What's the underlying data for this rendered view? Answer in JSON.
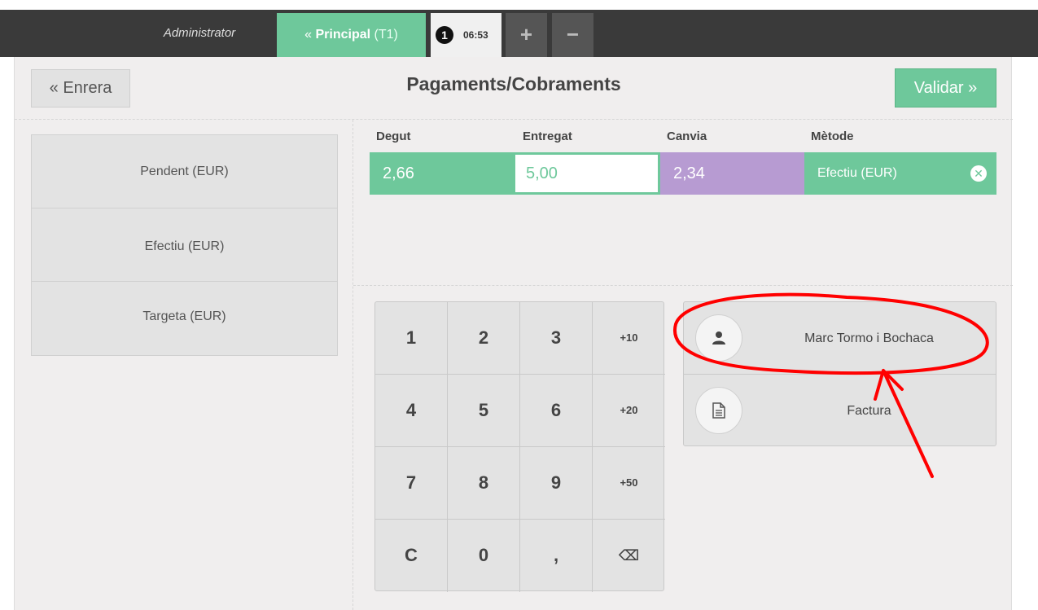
{
  "topbar": {
    "user": "Administrator",
    "tab_principal_label": "Principal",
    "tab_principal_table": "(T1)",
    "order_badge": "1",
    "order_time": "06:53",
    "add_label": "+",
    "remove_label": "−"
  },
  "header": {
    "back_label": "« Enrera",
    "title": "Pagaments/Cobraments",
    "validate_label": "Validar »"
  },
  "methods": [
    {
      "label": "Pendent (EUR)"
    },
    {
      "label": "Efectiu (EUR)"
    },
    {
      "label": "Targeta (EUR)"
    }
  ],
  "lines": {
    "headers": {
      "due": "Degut",
      "tendered": "Entregat",
      "change": "Canvia",
      "method": "Mètode"
    },
    "due": "2,66",
    "tendered": "5,00",
    "change": "2,34",
    "method": "Efectiu (EUR)"
  },
  "numpad": {
    "keys": [
      "1",
      "2",
      "3",
      "+10",
      "4",
      "5",
      "6",
      "+20",
      "7",
      "8",
      "9",
      "+50",
      "C",
      "0",
      ",",
      "⌫"
    ]
  },
  "actions": {
    "customer_label": "Marc Tormo i Bochaca",
    "invoice_label": "Factura"
  },
  "colors": {
    "accent_green": "#6ec89b",
    "change_purple": "#b79bd2",
    "annotation_red": "#ff0000"
  },
  "icons": {
    "back": "double-chevron-left-icon",
    "customer": "user-icon",
    "invoice": "document-icon",
    "remove_line": "close-circle-icon",
    "backspace": "backspace-icon"
  }
}
